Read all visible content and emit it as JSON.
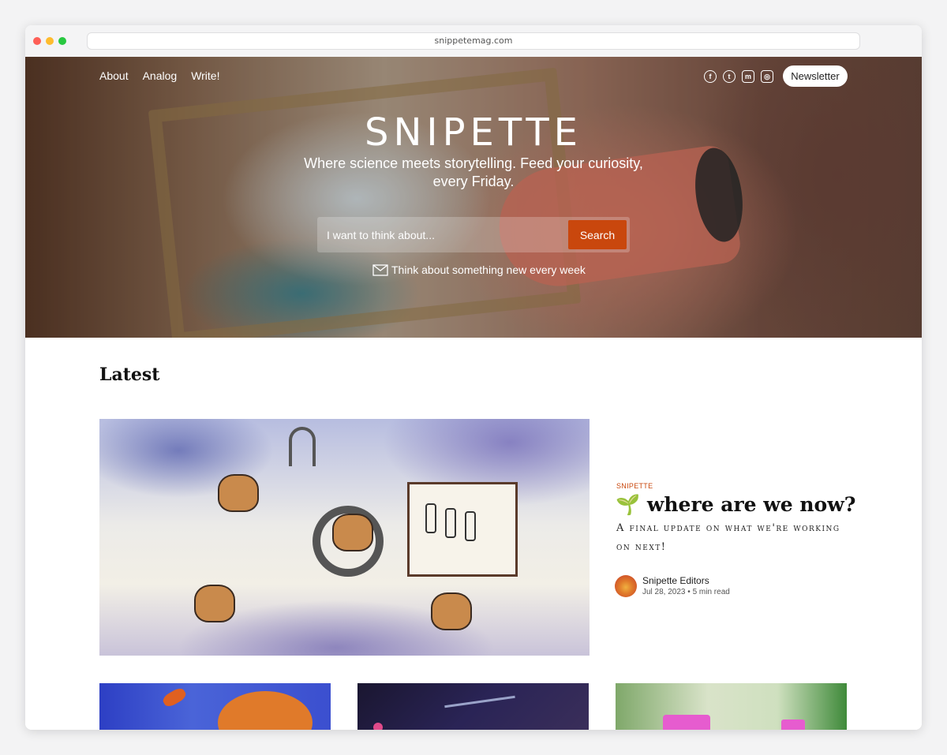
{
  "browser": {
    "url": "snippetemag.com"
  },
  "nav": {
    "about": "About",
    "analog": "Analog",
    "write": "Write!"
  },
  "social": {
    "facebook": "f",
    "twitter": "t",
    "mastodon": "m",
    "instagram": "◎"
  },
  "header": {
    "newsletter_label": "Newsletter"
  },
  "hero": {
    "logo": "SNIPETTE",
    "tagline": "Where science meets storytelling. Feed your curiosity, every Friday.",
    "search_placeholder": "I want to think about...",
    "search_button": "Search",
    "weekly_text": "Think about something new every week"
  },
  "latest": {
    "heading": "Latest",
    "featured": {
      "tag": "SNIPETTE",
      "emoji": "🌱",
      "title": "where are we now?",
      "subtitle": "A final update on what we're working on next!",
      "author": "Snipette Editors",
      "date": "Jul 28, 2023",
      "separator": "•",
      "read_time": "5 min read"
    }
  },
  "colors": {
    "accent": "#c9470d",
    "text": "#111111"
  },
  "icons": [
    "facebook-icon",
    "twitter-icon",
    "mastodon-icon",
    "instagram-icon",
    "envelope-icon"
  ]
}
